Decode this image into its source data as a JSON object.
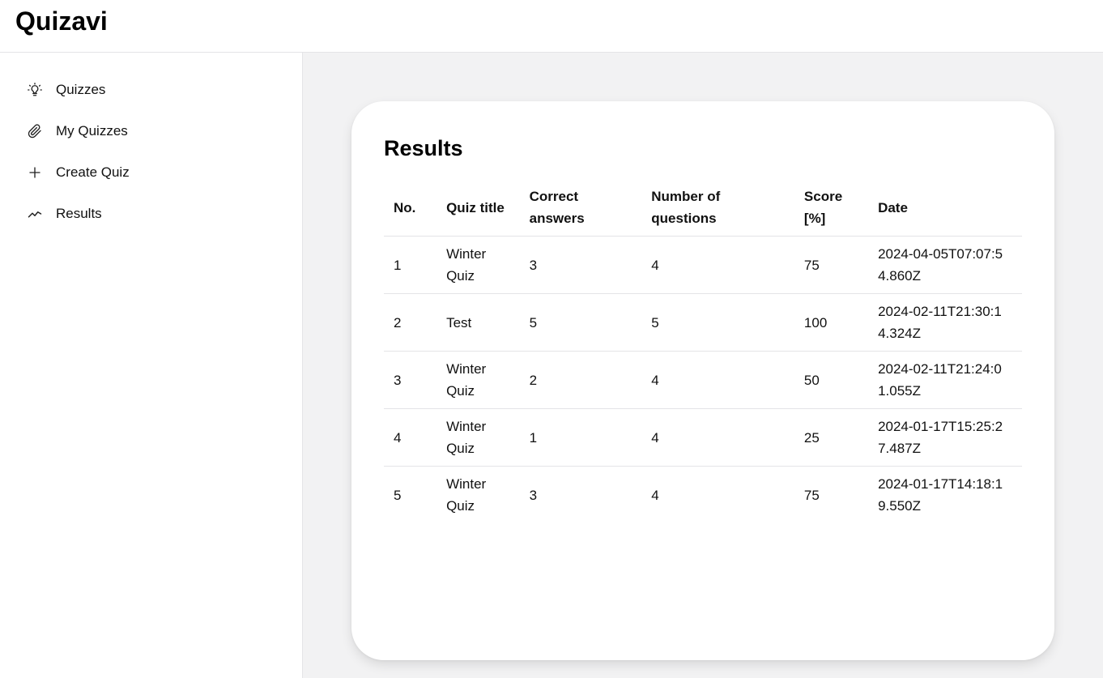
{
  "app": {
    "title": "Quizavi"
  },
  "sidebar": {
    "items": [
      {
        "label": "Quizzes",
        "icon": "lightbulb-icon"
      },
      {
        "label": "My Quizzes",
        "icon": "paperclip-icon"
      },
      {
        "label": "Create Quiz",
        "icon": "plus-icon"
      },
      {
        "label": "Results",
        "icon": "trend-line-icon"
      }
    ]
  },
  "results": {
    "title": "Results",
    "headers": {
      "no": "No.",
      "quiz_title": "Quiz title",
      "correct": "Correct answers",
      "num_questions": "Number of questions",
      "score": "Score [%]",
      "date": "Date"
    },
    "rows": [
      {
        "no": "1",
        "quiz_title": "Winter Quiz",
        "correct": "3",
        "num_questions": "4",
        "score": "75",
        "date": "2024-04-05T07:07:54.860Z"
      },
      {
        "no": "2",
        "quiz_title": "Test",
        "correct": "5",
        "num_questions": "5",
        "score": "100",
        "date": "2024-02-11T21:30:14.324Z"
      },
      {
        "no": "3",
        "quiz_title": "Winter Quiz",
        "correct": "2",
        "num_questions": "4",
        "score": "50",
        "date": "2024-02-11T21:24:01.055Z"
      },
      {
        "no": "4",
        "quiz_title": "Winter Quiz",
        "correct": "1",
        "num_questions": "4",
        "score": "25",
        "date": "2024-01-17T15:25:27.487Z"
      },
      {
        "no": "5",
        "quiz_title": "Winter Quiz",
        "correct": "3",
        "num_questions": "4",
        "score": "75",
        "date": "2024-01-17T14:18:19.550Z"
      }
    ]
  }
}
